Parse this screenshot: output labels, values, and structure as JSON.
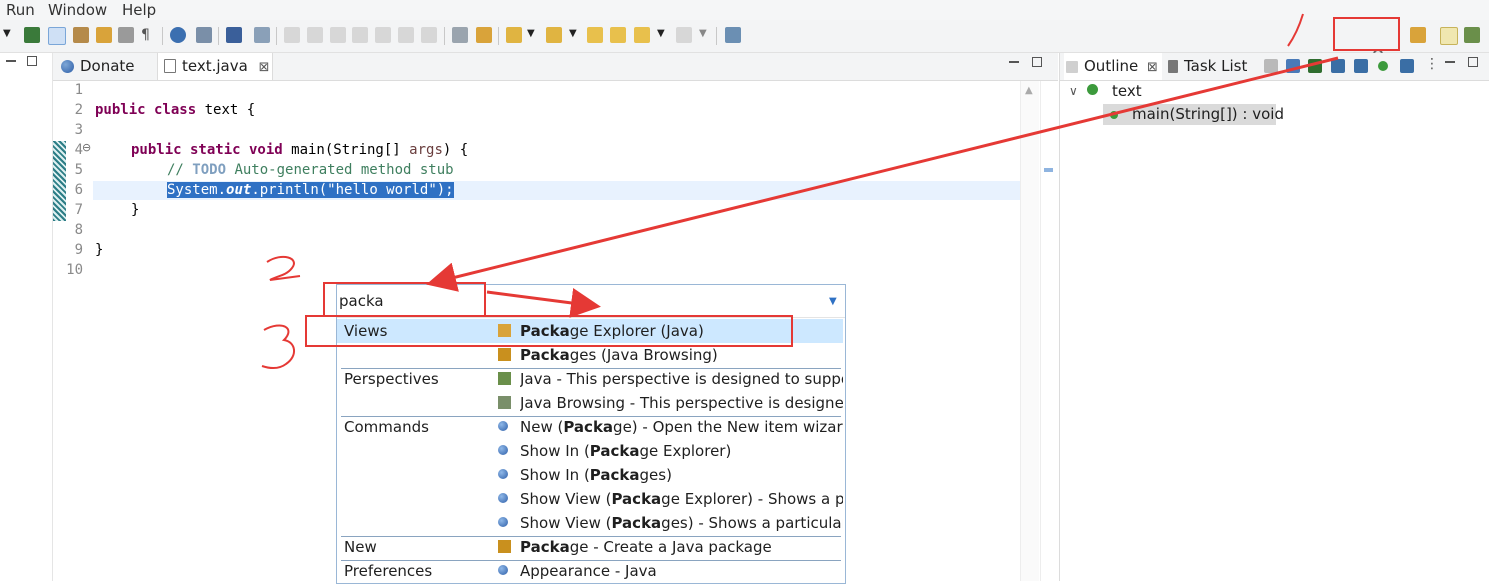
{
  "menu": [
    "Run",
    "Window",
    "Help"
  ],
  "editor": {
    "tabs": [
      {
        "label": "Donate"
      },
      {
        "label": "text.java",
        "close": "⊠"
      }
    ],
    "lines": [
      "1",
      "2",
      "3",
      "4",
      "5",
      "6",
      "7",
      "8",
      "9",
      "10"
    ],
    "code": {
      "l2_kw": "public class",
      "l2_rest": " text {",
      "l4_kw": "public static void",
      "l4_rest_a": " main(String[] ",
      "l4_param": "args",
      "l4_rest_b": ") {",
      "l5_cm_a": "// ",
      "l5_todo": "TODO",
      "l5_cm_b": " Auto-generated method stub",
      "l6_a": "System.",
      "l6_b": "out",
      "l6_c": ".println(\"hello world\");",
      "l7": "}",
      "l9": "}"
    }
  },
  "outline": {
    "tabs": [
      {
        "label": "Outline",
        "close": "⊠"
      },
      {
        "label": "Task List"
      }
    ],
    "class_name": "text",
    "method": "main(String[]) : void"
  },
  "quick_access": {
    "input_value": "packa",
    "categories": {
      "views": "Views",
      "perspectives": "Perspectives",
      "commands": "Commands",
      "new": "New",
      "preferences": "Preferences"
    },
    "results": [
      {
        "bold": "Packa",
        "rest": "ge Explorer (Java)"
      },
      {
        "bold": "Packa",
        "rest": "ges (Java Browsing)"
      },
      {
        "text": "Java - This perspective is designed to support Java development"
      },
      {
        "text": "Java Browsing - This perspective is designed to support Java code browsing"
      },
      {
        "pre": "New (",
        "bold": "Packa",
        "rest": "ge) - Open the New item wizard"
      },
      {
        "pre": "Show In (",
        "bold": "Packa",
        "rest": "ge Explorer)"
      },
      {
        "pre": "Show In (",
        "bold": "Packa",
        "rest": "ges)"
      },
      {
        "pre": "Show View (",
        "bold": "Packa",
        "rest": "ge Explorer) - Shows a particular view"
      },
      {
        "pre": "Show View (",
        "bold": "Packa",
        "rest": "ges) - Shows a particular view"
      },
      {
        "bold": "Packa",
        "rest": "ge - Create a Java package"
      },
      {
        "text": "Appearance - Java"
      }
    ]
  },
  "annotations": {
    "step1": "/",
    "step2": "2",
    "step3": "3"
  },
  "colors": {
    "accent": "#2f71c4",
    "annotation": "#e53935",
    "keyword": "#7f0055",
    "comment": "#3f7f5f"
  }
}
